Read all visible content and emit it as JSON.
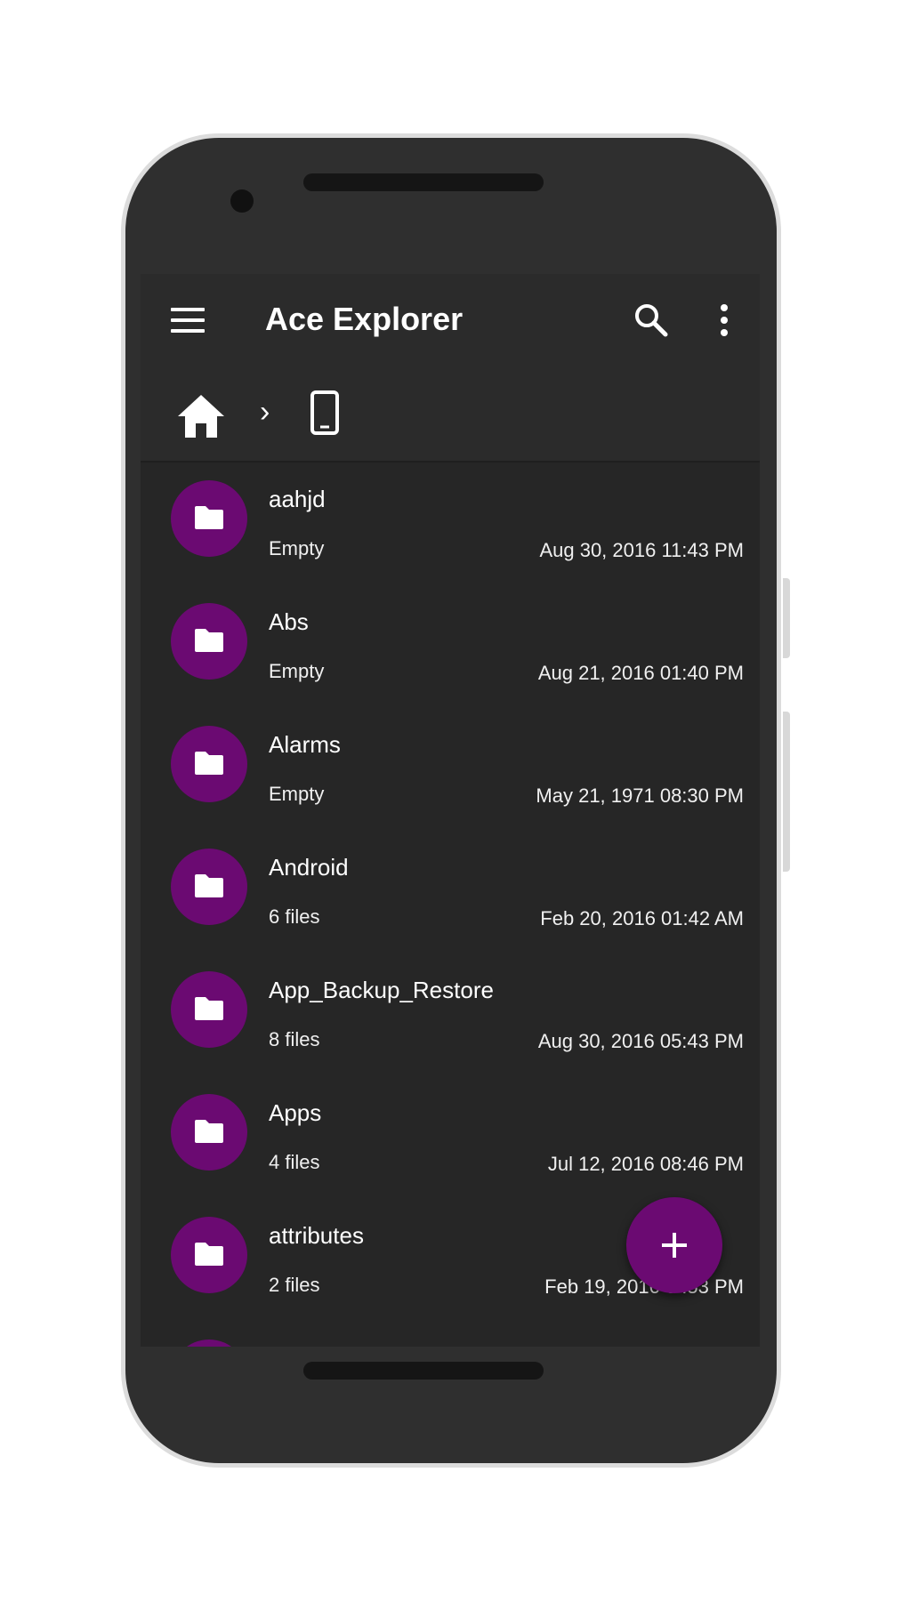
{
  "app": {
    "title": "Ace Explorer"
  },
  "toolbar": {
    "menu_icon": "hamburger-menu-icon",
    "search_icon": "search-icon",
    "more_icon": "more-vertical-icon"
  },
  "breadcrumb": {
    "home_icon": "home-icon",
    "separator": "›",
    "device_icon": "phone-device-icon"
  },
  "files": [
    {
      "name": "aahjd",
      "meta": "Empty",
      "date": "Aug 30, 2016 11:43 PM"
    },
    {
      "name": "Abs",
      "meta": "Empty",
      "date": "Aug 21, 2016 01:40 PM"
    },
    {
      "name": "Alarms",
      "meta": "Empty",
      "date": "May 21, 1971 08:30 PM"
    },
    {
      "name": "Android",
      "meta": "6 files",
      "date": "Feb 20, 2016 01:42 AM"
    },
    {
      "name": "App_Backup_Restore",
      "meta": "8 files",
      "date": "Aug 30, 2016 05:43 PM"
    },
    {
      "name": "Apps",
      "meta": "4 files",
      "date": "Jul 12, 2016 08:46 PM"
    },
    {
      "name": "attributes",
      "meta": "2 files",
      "date": "Feb 19, 2016 0 :53 PM"
    }
  ],
  "fab": {
    "icon": "plus-icon"
  },
  "colors": {
    "accent": "#6b0a72",
    "background": "#262626",
    "toolbar": "#2b2b2b"
  }
}
